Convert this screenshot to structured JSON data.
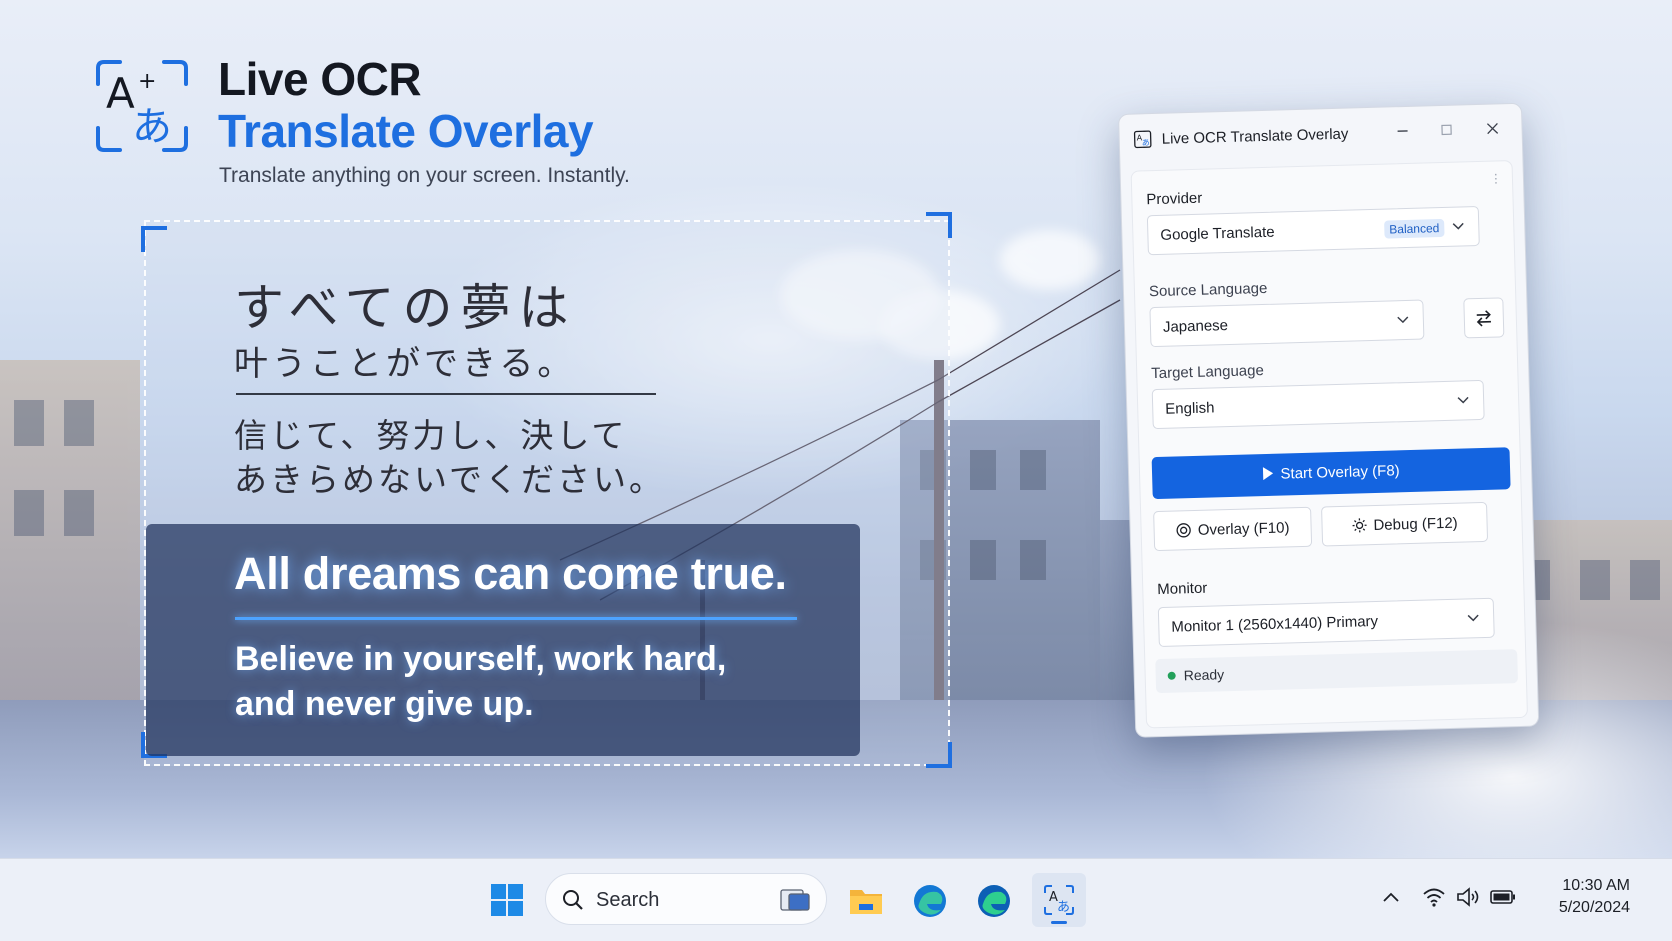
{
  "brand": {
    "title": "Live OCR",
    "subtitle": "Translate Overlay",
    "tagline": "Translate anything on your screen. Instantly."
  },
  "capture": {
    "source_line1": "すべての夢は",
    "source_line2": "叶うことができる。",
    "source_line3": "信じて、努力し、決して",
    "source_line4": "あきらめないでください。",
    "translation_main": "All dreams can come true.",
    "translation_line1": "Believe in yourself, work hard,",
    "translation_line2": "and never give up."
  },
  "window": {
    "title": "Live OCR Translate Overlay",
    "provider_label": "Provider",
    "provider_value": "Google Translate",
    "provider_badge": "Balanced",
    "source_label": "Source Language",
    "source_value": "Japanese",
    "target_label": "Target Language",
    "target_value": "English",
    "start_label": "Start Overlay (F8)",
    "overlay_label": "Overlay (F10)",
    "debug_label": "Debug (F12)",
    "monitor_label": "Monitor",
    "monitor_value": "Monitor 1 (2560x1440) Primary",
    "status_text": "Ready"
  },
  "taskbar": {
    "search_label": "Search",
    "time": "10:30 AM",
    "date": "5/20/2024",
    "icons": [
      "start-icon",
      "search-icon",
      "task-view-icon",
      "file-explorer-icon",
      "edge-icon",
      "edge-beta-icon",
      "live-ocr-app-icon",
      "chevron-up-icon",
      "wifi-icon",
      "volume-icon",
      "battery-icon"
    ]
  },
  "colors": {
    "accent": "#1e6fe0",
    "primary_button": "#1464e0",
    "status_ready": "#22a05a"
  }
}
